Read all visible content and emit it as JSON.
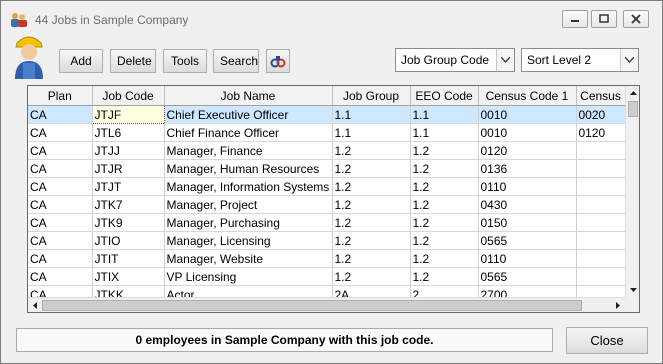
{
  "window": {
    "title": "44 Jobs in Sample Company"
  },
  "toolbar": {
    "add_label": "Add",
    "delete_label": "Delete",
    "tools_label": "Tools",
    "search_label": "Search",
    "group_combo_value": "Job Group Code",
    "sort_combo_value": "Sort Level 2"
  },
  "grid": {
    "headers": [
      "Plan",
      "Job Code",
      "Job Name",
      "Job Group",
      "EEO Code",
      "Census Code 1",
      "Census"
    ],
    "rows": [
      [
        "CA",
        "JTJF",
        "Chief Executive Officer",
        "1.1",
        "1.1",
        "0010",
        "0020"
      ],
      [
        "CA",
        "JTL6",
        "Chief Finance Officer",
        "1.1",
        "1.1",
        "0010",
        "0120"
      ],
      [
        "CA",
        "JTJJ",
        "Manager, Finance",
        "1.2",
        "1.2",
        "0120",
        ""
      ],
      [
        "CA",
        "JTJR",
        "Manager, Human Resources",
        "1.2",
        "1.2",
        "0136",
        ""
      ],
      [
        "CA",
        "JTJT",
        "Manager, Information Systems",
        "1.2",
        "1.2",
        "0110",
        ""
      ],
      [
        "CA",
        "JTK7",
        "Manager, Project",
        "1.2",
        "1.2",
        "0430",
        ""
      ],
      [
        "CA",
        "JTK9",
        "Manager, Purchasing",
        "1.2",
        "1.2",
        "0150",
        ""
      ],
      [
        "CA",
        "JTIO",
        "Manager, Licensing",
        "1.2",
        "1.2",
        "0565",
        ""
      ],
      [
        "CA",
        "JTIT",
        "Manager, Website",
        "1.2",
        "1.2",
        "0110",
        ""
      ],
      [
        "CA",
        "JTIX",
        "VP Licensing",
        "1.2",
        "1.2",
        "0565",
        ""
      ],
      [
        "CA",
        "JTKK",
        "Actor",
        "2A",
        "2",
        "2700",
        ""
      ]
    ]
  },
  "status": {
    "text": "0 employees in Sample Company with this job code."
  },
  "close_label": "Close"
}
